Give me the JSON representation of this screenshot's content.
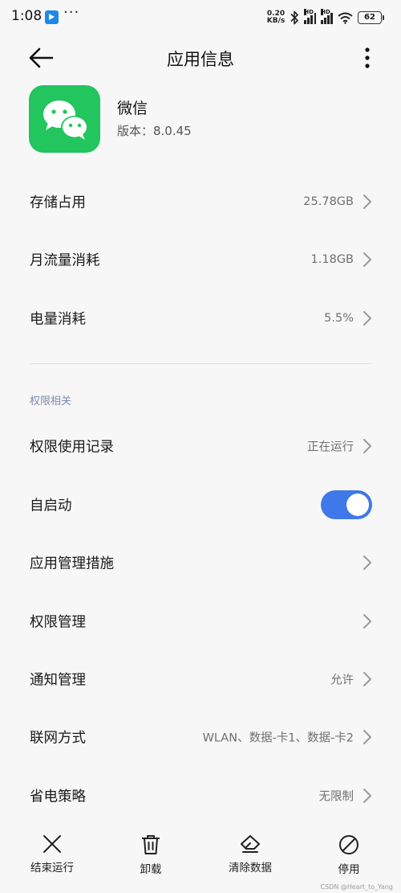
{
  "status_bar": {
    "time": "1:08",
    "more": "···",
    "net_speed_value": "0.20",
    "net_speed_unit": "KB/s",
    "sim1_tag": "HD",
    "sim2_tag": "HD",
    "battery": "62",
    "icons": [
      "app-notification-icon",
      "bluetooth-icon",
      "signal-icon",
      "wifi-icon",
      "battery-icon"
    ]
  },
  "header": {
    "title": "应用信息",
    "back_icon": "arrow-left-icon",
    "more_icon": "more-vertical-icon"
  },
  "app": {
    "name": "微信",
    "version": "版本：8.0.45",
    "logo_color": "#22c55e"
  },
  "usage_rows": [
    {
      "label": "存储占用",
      "value": "25.78GB"
    },
    {
      "label": "月流量消耗",
      "value": "1.18GB"
    },
    {
      "label": "电量消耗",
      "value": "5.5%"
    }
  ],
  "permissions": {
    "section_title": "权限相关",
    "rows": [
      {
        "label": "权限使用记录",
        "value": "正在运行"
      },
      {
        "label": "自启动",
        "toggle_on": true
      },
      {
        "label": "应用管理措施",
        "value": ""
      },
      {
        "label": "权限管理",
        "value": ""
      },
      {
        "label": "通知管理",
        "value": "允许"
      },
      {
        "label": "联网方式",
        "value": "WLAN、数据-卡1、数据-卡2"
      },
      {
        "label": "省电策略",
        "value": "无限制"
      }
    ]
  },
  "bottom_actions": [
    {
      "label": "结束运行",
      "icon": "close-icon"
    },
    {
      "label": "卸载",
      "icon": "trash-icon"
    },
    {
      "label": "清除数据",
      "icon": "eraser-icon"
    },
    {
      "label": "停用",
      "icon": "block-icon"
    }
  ],
  "watermark": "CSDN @Heart_to_Yang",
  "colors": {
    "accent": "#3f78e8",
    "section_title": "#7d8bb0",
    "background": "#f7f7f7"
  }
}
